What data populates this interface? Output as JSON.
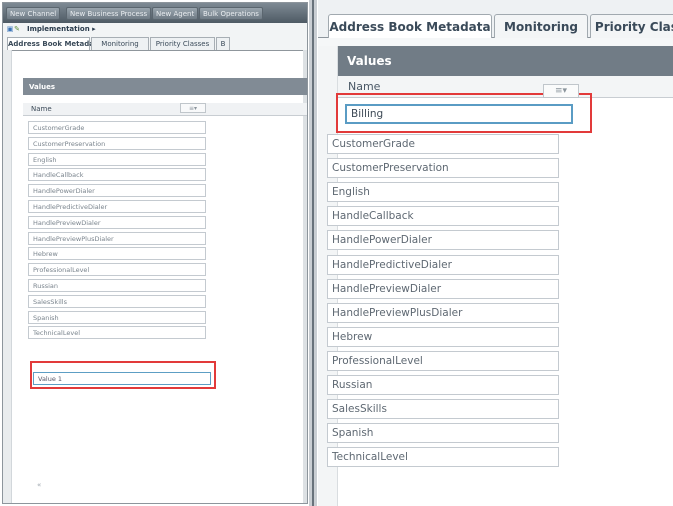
{
  "left_panel": {
    "toolbar_buttons": [
      "New Channel",
      "New Business Process",
      "New Agent",
      "Bulk Operations"
    ],
    "breadcrumb": "Implementation ▸",
    "tabs": [
      "Address Book Metadata",
      "Monitoring",
      "Priority Classes",
      "B"
    ],
    "values_title": "Values",
    "column_header": "Name",
    "sort_icon": "≡▾",
    "rows": [
      "CustomerGrade",
      "CustomerPreservation",
      "English",
      "HandleCallback",
      "HandlePowerDialer",
      "HandlePredictiveDialer",
      "HandlePreviewDialer",
      "HandlePreviewPlusDialer",
      "Hebrew",
      "ProfessionalLevel",
      "Russian",
      "SalesSkills",
      "Spanish",
      "TechnicalLevel"
    ],
    "new_row_value": "Value 1",
    "bottom_symbol": "«"
  },
  "right_panel": {
    "tabs": [
      "Address Book Metadata",
      "Monitoring",
      "Priority Class"
    ],
    "values_title": "Values",
    "column_header": "Name",
    "sort_icon": "≡▾",
    "editing_value": "Billing",
    "rows": [
      "CustomerGrade",
      "CustomerPreservation",
      "English",
      "HandleCallback",
      "HandlePowerDialer",
      "HandlePredictiveDialer",
      "HandlePreviewDialer",
      "HandlePreviewPlusDialer",
      "Hebrew",
      "ProfessionalLevel",
      "Russian",
      "SalesSkills",
      "Spanish",
      "TechnicalLevel"
    ]
  },
  "colors": {
    "highlight": "#e23a3a",
    "header_bar": "#717c86",
    "edit_border": "#5a9cc4"
  }
}
